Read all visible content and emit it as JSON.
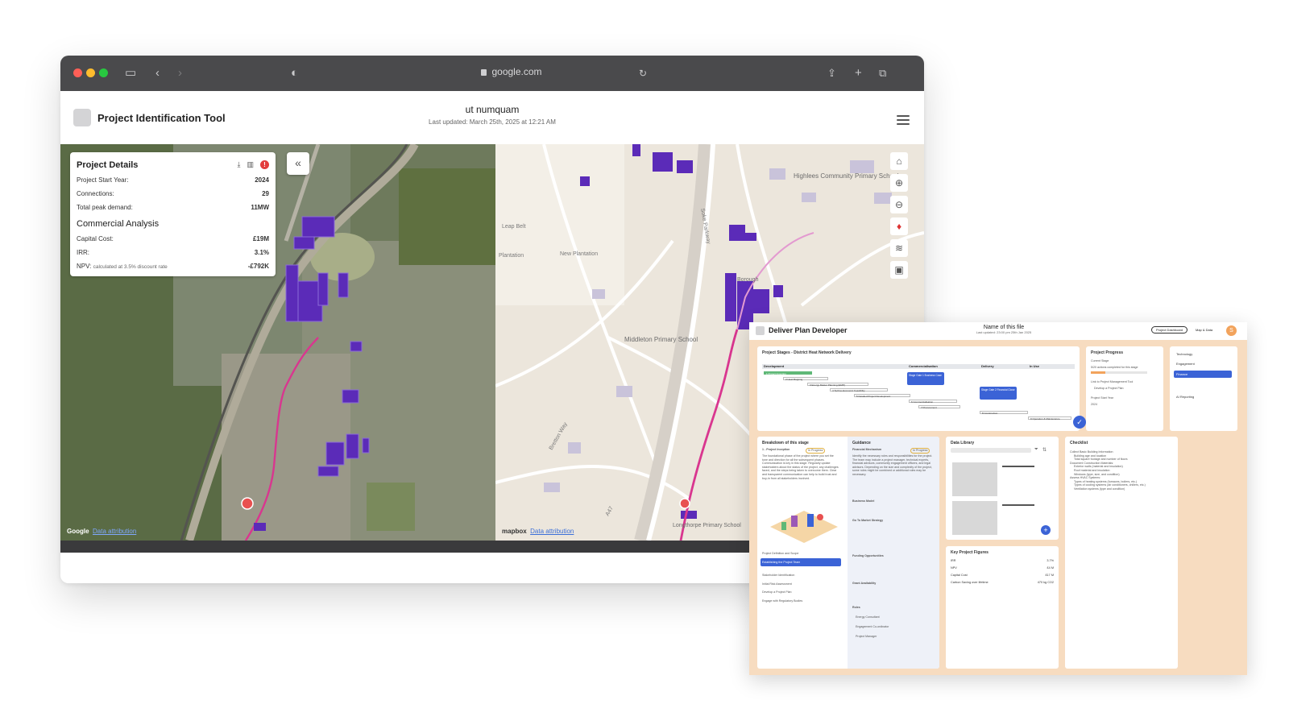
{
  "browser": {
    "url": "google.com",
    "colors": {
      "close": "#ff5f57",
      "minimize": "#febc2e",
      "zoom": "#28c840"
    },
    "icons": [
      "sidebar-icon",
      "back-icon",
      "forward-icon",
      "shield-icon",
      "lock-icon",
      "reload-icon",
      "share-icon",
      "new-tab-icon",
      "tab-overview-icon"
    ]
  },
  "app": {
    "title": "Project Identification Tool",
    "project_name": "ut numquam",
    "last_updated": "Last updated: March 25th, 2025 at 12:21 AM"
  },
  "project_details": {
    "title": "Project Details",
    "start_year_label": "Project Start Year:",
    "start_year": "2024",
    "connections_label": "Connections:",
    "connections": "29",
    "peak_label": "Total peak demand:",
    "peak": "11MW",
    "commercial_title": "Commercial Analysis",
    "capital_label": "Capital Cost:",
    "capital": "£19M",
    "irr_label": "IRR:",
    "irr": "3.1%",
    "npv_label": "NPV:",
    "npv_note": "calculated at 3.5% discount rate",
    "npv": "-£792K",
    "warning_count": "!"
  },
  "map": {
    "google_label": "Google",
    "data_attribution": "Data attribution",
    "mapbox_label": "mapbox",
    "place_labels": {
      "highlees": "Highlees Community Primary School",
      "middleton": "Middleton Primary School",
      "new_plantation": "New Plantation",
      "plantation": "Plantation",
      "leap_belt": "Leap Belt",
      "soke_parkway": "Soke Parkway",
      "bretton_way": "Bretton Way",
      "a47": "A47",
      "longthorpe": "Longthorpe Primary School",
      "borough": "Borough"
    }
  },
  "overlay": {
    "title": "Deliver Plan Developer",
    "file_name": "Name of this file",
    "file_updated": "Last updated: 23:00 pm 25th Jan 2025",
    "dashboard_btn": "Project Dashboard",
    "map_data": "Map & Data",
    "avatar": "S",
    "stages_title": "Project Stages - District Heat Network Delivery",
    "gantt_headers": [
      "Development",
      "Commercialisation",
      "Delivery",
      "In Use"
    ],
    "gantt_rows": [
      "1 Project Inception",
      "2 Heat Mapping",
      "3 Energy Master Planning (EMP)",
      "4 Techno-Economic Feasibility",
      "5 Detailed Project Development",
      "6 Commercialisation",
      "7 Procurement",
      "8 Construction",
      "9 Operation & Maintenance"
    ],
    "gate1": "Stage Gate 1 Business Case",
    "gate2": "Stage Gate 2 Financial Close",
    "progress_title": "Project Progress",
    "progress_current": "Current Stage",
    "progress_note": "5/20 actions completed for this stage",
    "link_label": "Link to Project Management Tool",
    "link_item": "Develop a Project Plan",
    "start_year_label": "Project Start Year",
    "start_year": "2024",
    "side_menu": [
      "Technology",
      "Engagement",
      "Finance",
      "AI Reporting"
    ],
    "breakdown_title": "Breakdown of this stage",
    "breakdown_stage": "1 - Project Inception",
    "breakdown_status": "In Progress",
    "breakdown_text": "The foundational phase of the project where you set the tone and direction for all the subsequent phases. Communication is key in this stage. Regularly update stakeholders about the status of the project, any challenges faced, and the steps being taken to overcome them. Clear and transparent communication can help to build trust and buy-in from all stakeholders involved.",
    "breakdown_items": [
      "Project Definition and Scope",
      "Establishing the Project Team",
      "Stakeholder Identification",
      "Initial Risk Assessment",
      "Develop a Project Plan",
      "Engage with Regulatory Bodies"
    ],
    "guidance_title": "Guidance",
    "guidance_first": "Financial Mechanism",
    "guidance_status": "In Progress",
    "guidance_text": "Identify the necessary roles and responsibilities for the project. The team may include a project manager, technical experts, financial advisors, community engagement officers, and legal advisors. Depending on the size and complexity of the project, some roles might be combined or additional roles may be necessary.",
    "guidance_items": [
      "Business Model",
      "Go To Market Strategy",
      "Funding Opportunities",
      "Grant Availability",
      "Roles"
    ],
    "roles": [
      "Energy Consultant",
      "Engagement Co-ordinator",
      "Project Manager"
    ],
    "library_title": "Data Library",
    "figures_title": "Key Project Figures",
    "figures": [
      {
        "label": "IRR",
        "value": "3.7%"
      },
      {
        "label": "NPV",
        "value": "£4 M"
      },
      {
        "label": "Capital Cost",
        "value": "£17 M"
      },
      {
        "label": "Carbon Saving over lifetime",
        "value": "470 kg CO2"
      }
    ],
    "checklist_title": "Checklist",
    "checklist": [
      "Collect Basic Building Information",
      "Building age and location",
      "Total square footage and number of floors",
      "Document Construction Materials:",
      "Exterior walls (material and insulation)",
      "Roof material and insulation",
      "Windows (type, size, and condition)",
      "Assess HVAC Systems:",
      "Types of heating systems (furnaces, boilers, etc.)",
      "Types of cooling systems (air conditioners, chillers, etc.)",
      "Ventilation systems (type and condition)"
    ]
  }
}
